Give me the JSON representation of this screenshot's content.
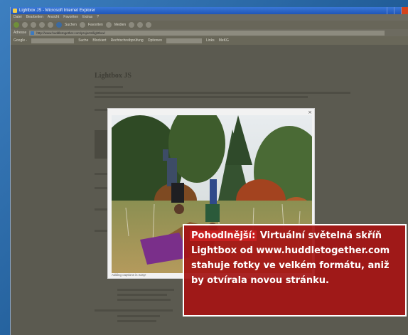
{
  "window": {
    "title": "Lightbox JS - Microsoft Internet Explorer",
    "menu": [
      "Datei",
      "Bearbeiten",
      "Ansicht",
      "Favoriten",
      "Extras",
      "?"
    ],
    "toolbar": {
      "search_label": "Suchen",
      "favorites_label": "Favoriten",
      "media_label": "Medien"
    },
    "address": {
      "label": "Adresse",
      "value": "http://www.huddletogether.com/projects/lightbox/"
    },
    "google": {
      "label": "Google -",
      "search_label": "Suche",
      "blocked_label": "Blockiert",
      "spell_label": "Rechtschreibprüfung",
      "options_label": "Optionen",
      "links_label": "Links",
      "skype_label": "MeKG"
    }
  },
  "page": {
    "heading": "Lightbox JS"
  },
  "lightbox": {
    "close_symbol": "×",
    "caption": "Adding captions is easy!"
  },
  "callout": {
    "lead": "Pohodlnější:",
    "text": " Virtuální světelná skříň Lightbox od www.huddletogether.com stahuje fotky ve velkém formátu, aniž by otvírala novou stránku."
  },
  "colors": {
    "callout_bg": "#a51414",
    "callout_lead": "#c81f1f",
    "desktop": "#2c6aa4"
  }
}
